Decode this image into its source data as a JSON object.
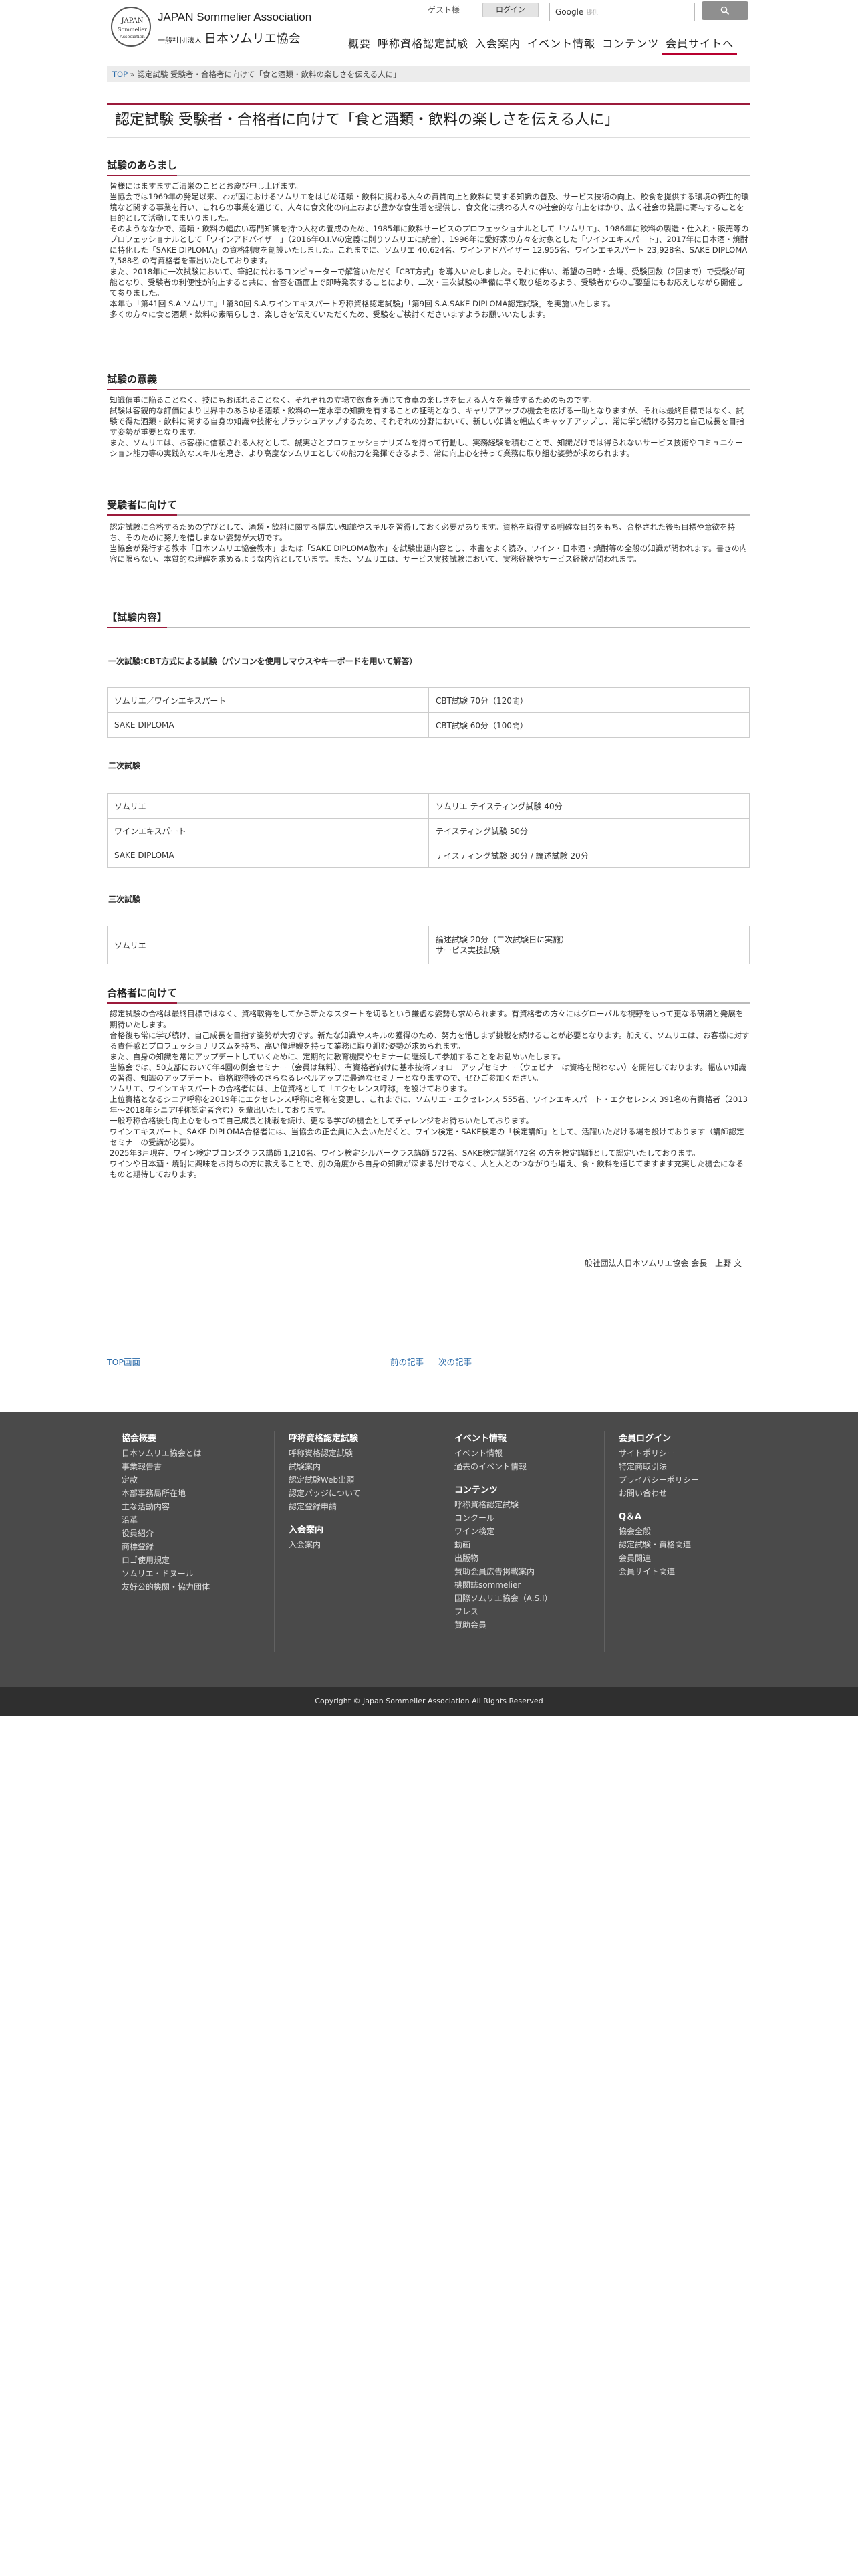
{
  "header": {
    "logo_circle": [
      "JAPAN",
      "Sommelier",
      "Association"
    ],
    "logo_en": "JAPAN Sommelier Association",
    "logo_jp_small": "一般社団法人",
    "logo_jp": "日本ソムリエ協会",
    "guest": "ゲスト様",
    "login": "ログイン",
    "search_brand": "Google",
    "search_placeholder": "提供",
    "search_icon": "magnifier-icon",
    "nav": [
      "概要",
      "呼称資格認定試験",
      "入会案内",
      "イベント情報",
      "コンテンツ",
      "会員サイトへ"
    ]
  },
  "breadcrumb": {
    "top": "TOP",
    "sep": " » ",
    "path": "認定試験 受験者・合格者に向けて「食と酒類・飲料の楽しさを伝える人に」"
  },
  "title": "認定試験 受験者・合格者に向けて「食と酒類・飲料の楽しさを伝える人に」",
  "sections": {
    "overview": {
      "heading": "試験のあらまし",
      "paragraphs": [
        "皆様にはますますご清栄のこととお慶び申し上げます。",
        "当協会では1969年の発足以来、わが国におけるソムリエをはじめ酒類・飲料に携わる人々の資質向上と飲料に関する知識の普及、サービス技術の向上、飲食を提供する環境の衛生的環境など関する事業を行い、これらの事業を通じて、人々に食文化の向上および豊かな食生活を提供し、食文化に携わる人々の社会的な向上をはかり、広く社会の発展に寄与することを目的として活動してまいりました。",
        "そのようななかで、酒類・飲料の幅広い専門知識を持つ人材の養成のため、1985年に飲料サービスのプロフェッショナルとして「ソムリエ」、1986年に飲料の製造・仕入れ・販売等のプロフェッショナルとして「ワインアドバイザー」（2016年O.I.Vの定義に則りソムリエに統合）、1996年に愛好家の方々を対象とした「ワインエキスパート」、2017年に日本酒・焼酎に特化した「SAKE DIPLOMA」の資格制度を創設いたしました。これまでに、ソムリエ 40,624名、ワインアドバイザー 12,955名、ワインエキスパート 23,928名、SAKE DIPLOMA 7,588名 の有資格者を輩出いたしております。",
        "また、2018年に一次試験において、筆記に代わるコンピューターで解答いただく「CBT方式」を導入いたしました。それに伴い、希望の日時・会場、受験回数（2回まで）で受験が可能となり、受験者の利便性が向上すると共に、合否を画面上で即時発表することにより、二次・三次試験の準備に早く取り組めるよう、受験者からのご要望にもお応えしながら開催して参りました。",
        "本年も「第41回 S.A.ソムリエ」「第30回 S.A.ワインエキスパート呼称資格認定試験」「第9回 S.A.SAKE DIPLOMA認定試験」を実施いたします。",
        "多くの方々に食と酒類・飲料の素晴らしさ、楽しさを伝えていただくため、受験をご検討くださいますようお願いいたします。"
      ]
    },
    "significance": {
      "heading": "試験の意義",
      "paragraphs": [
        "知識偏重に陥ることなく、技にもおぼれることなく、それぞれの立場で飲食を通じて食卓の楽しさを伝える人々を養成するためのものです。",
        "試験は客観的な評価により世界中のあらゆる酒類・飲料の一定水準の知識を有することの証明となり、キャリアアップの機会を広げる一助となりますが、それは最終目標ではなく、試験で得た酒類・飲料に関する自身の知識や技術をブラッシュアップするため、それぞれの分野において、新しい知識を幅広くキャッチアップし、常に学び続ける努力と自己成長を目指す姿勢が重要となります。",
        "また、ソムリエは、お客様に信頼される人材として、誠実さとプロフェッショナリズムを持って行動し、実務経験を積むことで、知識だけでは得られないサービス技術やコミュニケーション能力等の実践的なスキルを磨き、より高度なソムリエとしての能力を発揮できるよう、常に向上心を持って業務に取り組む姿勢が求められます。"
      ]
    },
    "candidates": {
      "heading": "受験者に向けて",
      "paragraphs": [
        "認定試験に合格するための学びとして、酒類・飲料に関する幅広い知識やスキルを習得しておく必要があります。資格を取得する明確な目的をもち、合格された後も目標や意欲を持ち、そのために努力を惜しまない姿勢が大切です。",
        "当協会が発行する教本「日本ソムリエ協会教本」または「SAKE DIPLOMA教本」を試験出題内容とし、本書をよく読み、ワイン・日本酒・焼酎等の全般の知識が問われます。書きの内容に限らない、本質的な理解を求めるような内容としています。また、ソムリエは、サービス実技試験において、実務経験やサービス経験が問われます。"
      ]
    },
    "content": {
      "heading": "【試験内容】",
      "first_label": "一次試験:CBT方式による試験（パソコンを使用しマウスやキーボードを用いて解答）",
      "first_rows": [
        [
          "ソムリエ／ワインエキスパート",
          "CBT試験 70分（120問）"
        ],
        [
          "SAKE DIPLOMA",
          "CBT試験 60分（100問）"
        ]
      ],
      "second_label": "二次試験",
      "second_rows": [
        [
          "ソムリエ",
          "ソムリエ テイスティング試験 40分"
        ],
        [
          "ワインエキスパート",
          "テイスティング試験 50分"
        ],
        [
          "SAKE DIPLOMA",
          "テイスティング試験 30分 / 論述試験 20分"
        ]
      ],
      "third_label": "三次試験",
      "third_rows": [
        [
          "ソムリエ",
          "論述試験 20分（二次試験日に実施）",
          "サービス実技試験"
        ]
      ]
    },
    "passers": {
      "heading": "合格者に向けて",
      "paragraphs": [
        "認定試験の合格は最終目標ではなく、資格取得をしてから新たなスタートを切るという謙虚な姿勢も求められます。有資格者の方々にはグローバルな視野をもって更なる研鑽と発展を期待いたします。",
        "合格後も常に学び続け、自己成長を目指す姿勢が大切です。新たな知識やスキルの獲得のため、努力を惜しまず挑戦を続けることが必要となります。加えて、ソムリエは、お客様に対する責任感とプロフェッショナリズムを持ち、高い倫理観を持って業務に取り組む姿勢が求められます。",
        "また、自身の知識を常にアップデートしていくために、定期的に教育機関やセミナーに継続して参加することをお勧めいたします。",
        "当協会では、50支部において年4回の例会セミナー（会員は無料）、有資格者向けに基本技術フォローアップセミナー（ウェビナーは資格を問わない）を開催しております。幅広い知識の習得、知識のアップデート、資格取得後のさらなるレベルアップに最適なセミナーとなりますので、ぜひご参加ください。",
        "ソムリエ、ワインエキスパートの合格者には、上位資格として「エクセレンス呼称」を設けております。",
        "上位資格となるシニア呼称を2019年にエクセレンス呼称に名称を変更し、これまでに、ソムリエ・エクセレンス 555名、ワインエキスパート・エクセレンス 391名の有資格者（2013年〜2018年シニア呼称認定者含む）を輩出いたしております。",
        "一般呼称合格後も向上心をもって自己成長と挑戦を続け、更なる学びの機会としてチャレンジをお待ちいたしております。",
        "ワインエキスパート、SAKE DIPLOMA合格者には、当協会の正会員に入会いただくと、ワイン検定・SAKE検定の「検定講師」として、活躍いただける場を設けております（講師認定セミナーの受講が必要）。",
        "2025年3月現在、ワイン検定ブロンズクラス講師 1,210名、ワイン検定シルバークラス講師 572名、SAKE検定講師472名 の方を検定講師として認定いたしております。",
        "ワインや日本酒・焼酎に興味をお持ちの方に教えることで、別の角度から自身の知識が深まるだけでなく、人と人とのつながりも増え、食・飲料を通じてますます充実した機会になるものと期待しております。"
      ]
    }
  },
  "signature": "一般社団法人日本ソムリエ協会 会長　上野 文一",
  "pager": {
    "top": "TOP画面",
    "prev": "前の記事",
    "next": "次の記事"
  },
  "footer": {
    "col1": {
      "heading": "協会概要",
      "links": [
        "日本ソムリエ協会とは",
        "事業報告書",
        "定款",
        "本部事務局所在地",
        "主な活動内容",
        "沿革",
        "役員紹介",
        "商標登録",
        "ロゴ使用規定",
        "ソムリエ・ドヌール",
        "友好公的機関・協力団体"
      ]
    },
    "col2": {
      "heading": "呼称資格認定試験",
      "links": [
        "呼称資格認定試験",
        "試験案内",
        "認定試験Web出願",
        "認定バッジについて",
        "認定登録申請"
      ],
      "heading2": "入会案内",
      "links2": [
        "入会案内"
      ]
    },
    "col3": {
      "heading": "イベント情報",
      "links": [
        "イベント情報",
        "過去のイベント情報"
      ],
      "heading2": "コンテンツ",
      "links2": [
        "呼称資格認定試験",
        "コンクール",
        "ワイン検定",
        "動画",
        "出版物",
        "賛助会員広告掲載案内",
        "機関誌sommelier",
        "国際ソムリエ協会（A.S.I）",
        "プレス",
        "賛助会員"
      ]
    },
    "col4": {
      "heading": "会員ログイン",
      "links": [
        "サイトポリシー",
        "特定商取引法",
        "プライバシーポリシー",
        "お問い合わせ"
      ],
      "heading2": "Q＆A",
      "links2": [
        "協会全般",
        "認定試験・資格関連",
        "会員関連",
        "会員サイト関連"
      ]
    }
  },
  "copyright": "Copyright © Japan Sommelier Association All Rights Reserved",
  "colors": {
    "accent": "#9c1a3b",
    "link": "#2a6aa8",
    "footer_bg": "#4a4a4a",
    "copyright_bg": "#2f2f2f"
  }
}
